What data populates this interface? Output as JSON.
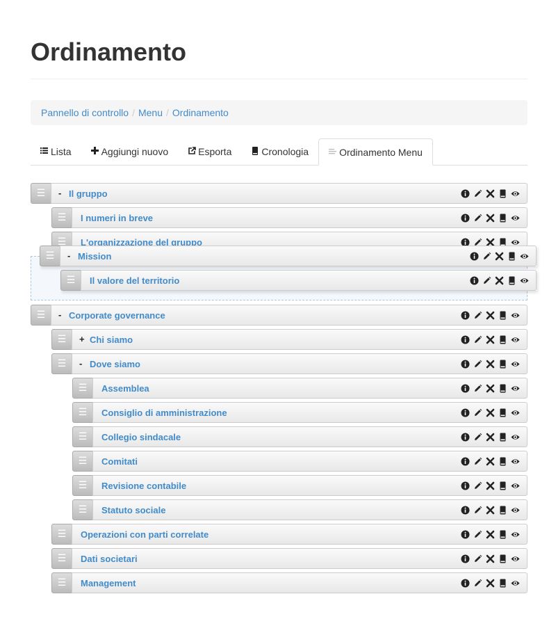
{
  "page": {
    "title": "Ordinamento"
  },
  "breadcrumb": [
    {
      "label": "Pannello di controllo"
    },
    {
      "label": "Menu"
    },
    {
      "label": "Ordinamento"
    }
  ],
  "breadcrumb_separator": "/",
  "tabs": [
    {
      "label": "Lista",
      "icon": "list-icon"
    },
    {
      "label": "Aggiungi nuovo",
      "icon": "plus-icon"
    },
    {
      "label": "Esporta",
      "icon": "export-icon"
    },
    {
      "label": "Cronologia",
      "icon": "book-icon"
    },
    {
      "label": "Ordinamento Menu",
      "icon": "sort-icon",
      "active": true
    }
  ],
  "handle_glyph": "☰",
  "items": [
    {
      "label": "Il gruppo",
      "toggle": "-"
    },
    {
      "label": "I numeri in breve",
      "toggle": ""
    },
    {
      "label": "L'organizzazione del gruppo",
      "toggle": ""
    },
    {
      "label": "Mission",
      "toggle": "-",
      "dragging": true
    },
    {
      "label": "Il valore del territorio",
      "toggle": "",
      "dragging": true
    },
    {
      "label": "Corporate governance",
      "toggle": "-"
    },
    {
      "label": "Chi siamo",
      "toggle": "+"
    },
    {
      "label": "Dove siamo",
      "toggle": "-"
    },
    {
      "label": "Assemblea",
      "toggle": ""
    },
    {
      "label": "Consiglio di amministrazione",
      "toggle": ""
    },
    {
      "label": "Collegio sindacale",
      "toggle": ""
    },
    {
      "label": "Comitati",
      "toggle": ""
    },
    {
      "label": "Revisione contabile",
      "toggle": ""
    },
    {
      "label": "Statuto sociale",
      "toggle": ""
    },
    {
      "label": "Operazioni con parti correlate",
      "toggle": ""
    },
    {
      "label": "Dati societari",
      "toggle": ""
    },
    {
      "label": "Management",
      "toggle": ""
    }
  ],
  "item_actions": [
    "info-icon",
    "edit-icon",
    "delete-icon",
    "book-icon",
    "view-icon"
  ],
  "colors": {
    "link": "#428bca",
    "placeholder_border": "#aac7e0"
  }
}
